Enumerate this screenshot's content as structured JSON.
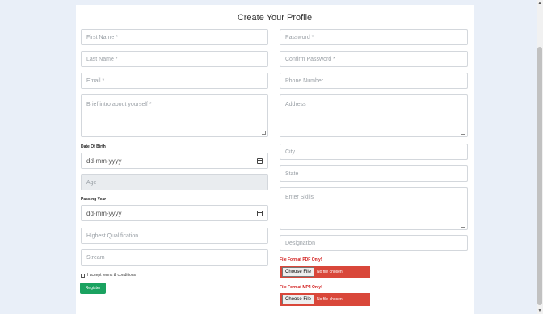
{
  "title": "Create Your Profile",
  "left": {
    "first_name": "First Name *",
    "last_name": "Last Name *",
    "email": "Email *",
    "intro": "Brief intro about yourself *",
    "dob_label": "Date Of Birth",
    "dob_value": "dd-mm-yyyy",
    "age": "Age",
    "passing_label": "Passing Year",
    "passing_value": "dd-mm-yyyy",
    "qualification": "Highest Qualification",
    "stream": "Stream",
    "terms": "I accept terms & conditions",
    "register": "Register"
  },
  "right": {
    "password": "Password *",
    "confirm_password": "Confirm Password *",
    "phone": "Phone Number",
    "address": "Address",
    "city": "City",
    "state": "State",
    "skills": "Enter Skills",
    "designation": "Designation",
    "pdf_label": "File Format PDF Only!",
    "mp4_label": "File Format MP4 Only!",
    "choose_file": "Choose File",
    "no_file": "No file chosen"
  },
  "icons": {
    "calendar": "calendar-icon",
    "resize": "resize-grip-icon"
  },
  "colors": {
    "accent_green": "#1aa260",
    "file_red": "#d9473a",
    "label_red": "#d11a1a"
  }
}
